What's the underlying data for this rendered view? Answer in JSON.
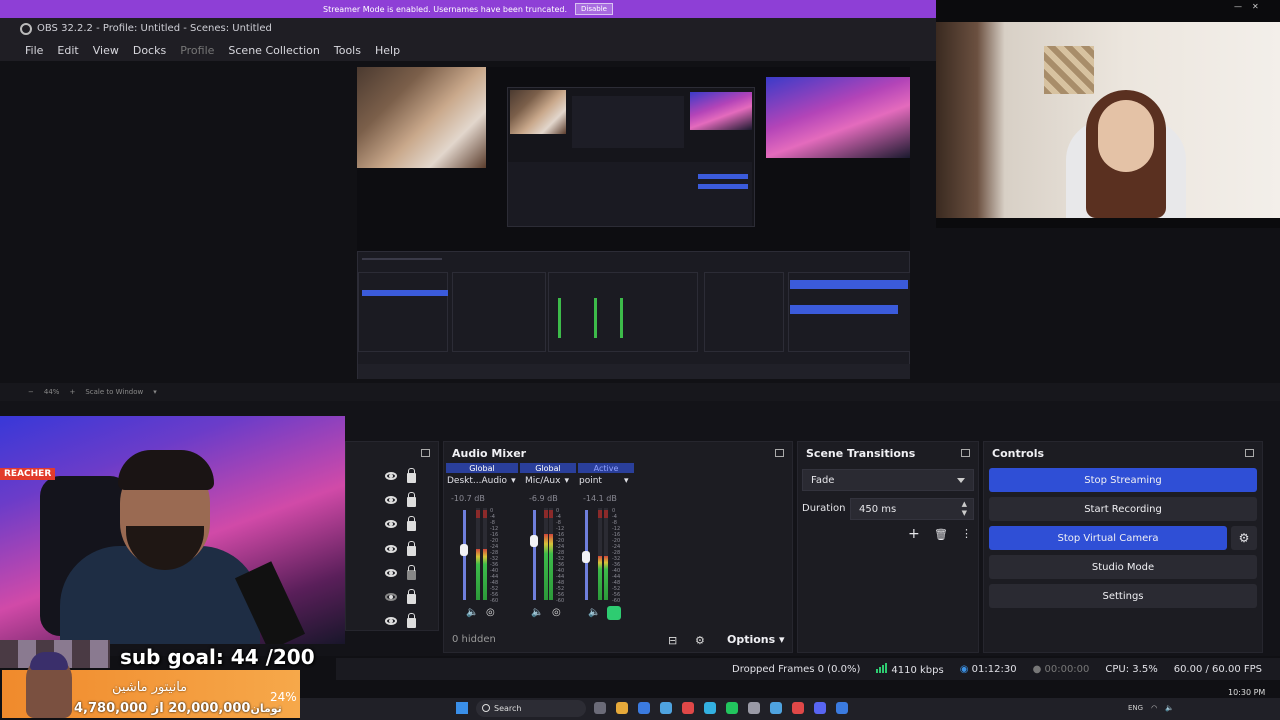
{
  "banner": {
    "message": "Streamer Mode is enabled. Usernames have been truncated.",
    "disable_label": "Disable"
  },
  "window": {
    "title": "OBS 32.2.2 - Profile: Untitled - Scenes: Untitled"
  },
  "menu": [
    "File",
    "Edit",
    "View",
    "Docks",
    "Profile",
    "Scene Collection",
    "Tools",
    "Help"
  ],
  "zoom": {
    "value": "44%",
    "mode": "Scale to Window"
  },
  "audio_mixer": {
    "title": "Audio Mixer",
    "channels": [
      {
        "scope": "Global",
        "name": "Deskt...Audio",
        "db": "-10.7 dB",
        "level": 0.55,
        "fader": 0.62
      },
      {
        "scope": "Global",
        "name": "Mic/Aux",
        "db": "-6.9 dB",
        "level": 0.72,
        "fader": 0.72
      },
      {
        "scope": "Active",
        "name": "point",
        "db": "-14.1 dB",
        "level": 0.48,
        "fader": 0.55
      }
    ],
    "scale": [
      "0",
      "-4",
      "-8",
      "-12",
      "-16",
      "-20",
      "-24",
      "-28",
      "-32",
      "-36",
      "-40",
      "-44",
      "-48",
      "-52",
      "-56",
      "-60"
    ],
    "hidden": "0 hidden",
    "options_label": "Options"
  },
  "scene_transitions": {
    "title": "Scene Transitions",
    "transition": "Fade",
    "duration_label": "Duration",
    "duration": "450 ms"
  },
  "controls": {
    "title": "Controls",
    "stop_streaming": "Stop Streaming",
    "start_recording": "Start Recording",
    "stop_virtual_camera": "Stop Virtual Camera",
    "studio_mode": "Studio Mode",
    "settings": "Settings"
  },
  "status": {
    "dropped_frames": "Dropped Frames 0 (0.0%)",
    "bitrate": "4110 kbps",
    "stream_time": "01:12:30",
    "record_time": "00:00:00",
    "cpu": "CPU: 3.5%",
    "fps": "60.00 / 60.00 FPS"
  },
  "overlay": {
    "sub_goal": "sub goal: 44 /200",
    "donation_title": "مانیتور ماشین",
    "donation_amounts": "20,000,000 از 4,780,000",
    "donation_suffix": "تومان",
    "donation_percent": "24%",
    "webcam_brand": "REACHER"
  },
  "taskbar": {
    "search_placeholder": "Search",
    "time": "10:30 PM",
    "tray_lang": "ENG"
  },
  "colors": {
    "accent": "#2f4fd6",
    "banner": "#8e3fd6",
    "active_green": "#2ecc71"
  }
}
